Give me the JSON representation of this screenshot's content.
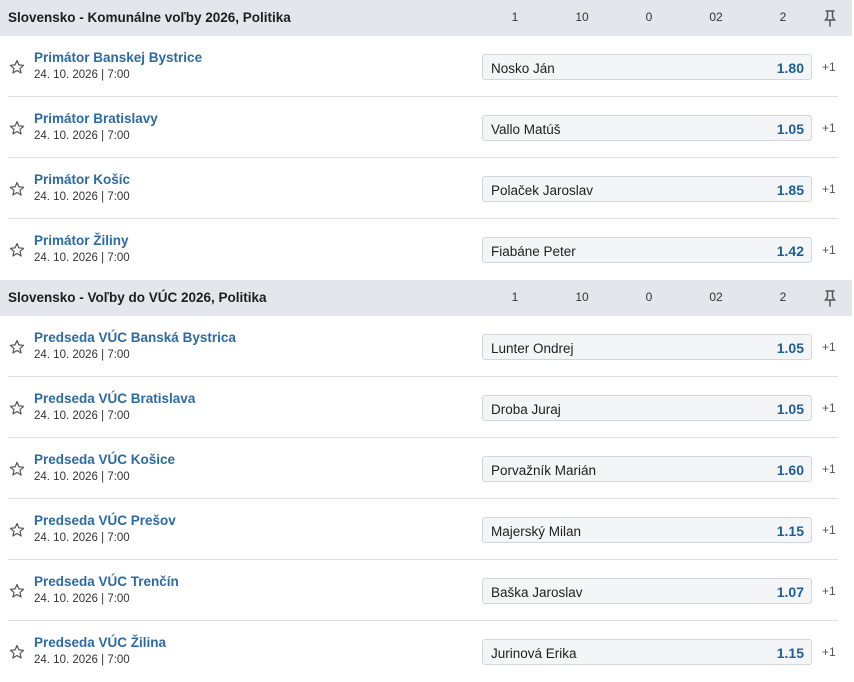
{
  "icons": {
    "favorite": "star-outline-icon",
    "pin": "pin-icon"
  },
  "colors": {
    "header_bg": "#e3e6ea",
    "link": "#2c6aa5",
    "odds": "#1f5f99"
  },
  "sections": [
    {
      "title": "Slovensko - Komunálne voľby 2026, Politika",
      "columns": [
        "1",
        "10",
        "0",
        "02",
        "2"
      ],
      "events": [
        {
          "name": "Primátor Banskej Bystrice",
          "date": "24. 10. 2026 | 7:00",
          "selection": "Nosko Ján",
          "odds": "1.80",
          "more": "+1"
        },
        {
          "name": "Primátor Bratislavy",
          "date": "24. 10. 2026 | 7:00",
          "selection": "Vallo Matúš",
          "odds": "1.05",
          "more": "+1"
        },
        {
          "name": "Primátor Košíc",
          "date": "24. 10. 2026 | 7:00",
          "selection": "Polaček Jaroslav",
          "odds": "1.85",
          "more": "+1"
        },
        {
          "name": "Primátor Žiliny",
          "date": "24. 10. 2026 | 7:00",
          "selection": "Fiabáne Peter",
          "odds": "1.42",
          "more": "+1"
        }
      ]
    },
    {
      "title": "Slovensko - Voľby do VÚC 2026, Politika",
      "columns": [
        "1",
        "10",
        "0",
        "02",
        "2"
      ],
      "events": [
        {
          "name": "Predseda VÚC Banská Bystrica",
          "date": "24. 10. 2026 | 7:00",
          "selection": "Lunter Ondrej",
          "odds": "1.05",
          "more": "+1"
        },
        {
          "name": "Predseda VÚC Bratislava",
          "date": "24. 10. 2026 | 7:00",
          "selection": "Droba Juraj",
          "odds": "1.05",
          "more": "+1"
        },
        {
          "name": "Predseda VÚC Košice",
          "date": "24. 10. 2026 | 7:00",
          "selection": "Porvažník Marián",
          "odds": "1.60",
          "more": "+1"
        },
        {
          "name": "Predseda VÚC Prešov",
          "date": "24. 10. 2026 | 7:00",
          "selection": "Majerský Milan",
          "odds": "1.15",
          "more": "+1"
        },
        {
          "name": "Predseda VÚC Trenčín",
          "date": "24. 10. 2026 | 7:00",
          "selection": "Baška Jaroslav",
          "odds": "1.07",
          "more": "+1"
        },
        {
          "name": "Predseda VÚC Žilina",
          "date": "24. 10. 2026 | 7:00",
          "selection": "Jurinová Erika",
          "odds": "1.15",
          "more": "+1"
        }
      ]
    }
  ]
}
